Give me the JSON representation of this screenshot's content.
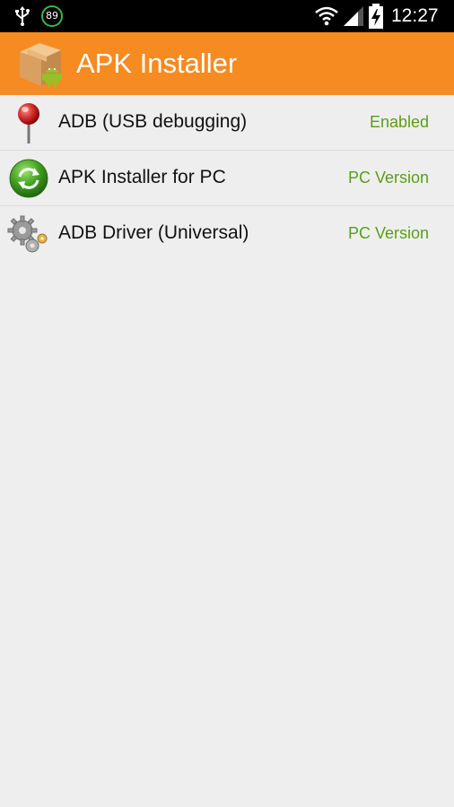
{
  "status_bar": {
    "battery_level": "89",
    "time": "12:27",
    "icons": [
      "usb-icon",
      "battery-badge",
      "wifi-icon",
      "signal-icon",
      "battery-charging-icon"
    ]
  },
  "action_bar": {
    "title": "APK Installer",
    "icon": "apk-box-icon"
  },
  "colors": {
    "action_bar": "#f58b21",
    "status_text": "#5a9e1b",
    "background": "#eeeeee"
  },
  "items": [
    {
      "label": "ADB (USB debugging)",
      "status": "Enabled",
      "icon": "pushpin-icon"
    },
    {
      "label": "APK Installer for PC",
      "status": "PC Version",
      "icon": "refresh-icon"
    },
    {
      "label": "ADB Driver (Universal)",
      "status": "PC Version",
      "icon": "gears-icon"
    }
  ]
}
